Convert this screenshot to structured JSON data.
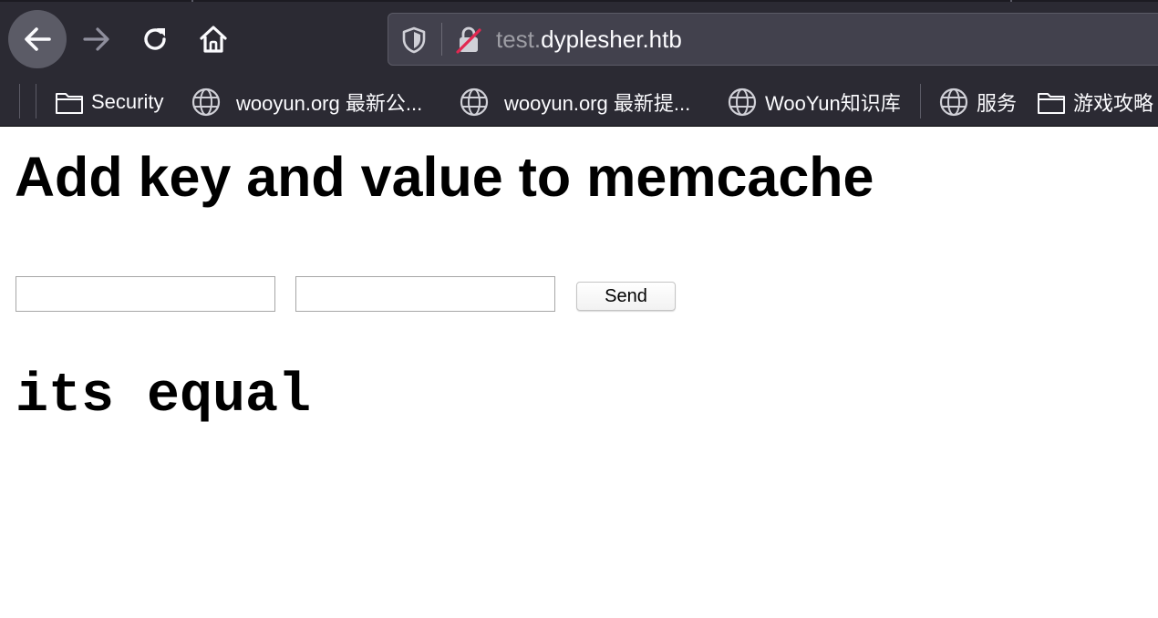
{
  "browser": {
    "url_subdomain": "test.",
    "url_domain": "dyplesher.htb",
    "icons": {
      "back": "back-arrow-icon",
      "forward": "forward-arrow-icon",
      "reload": "reload-icon",
      "home": "home-icon",
      "tracking": "shield-icon",
      "insecure": "insecure-lock-icon"
    },
    "bookmarks": [
      {
        "label": "Security",
        "icon": "folder-icon"
      },
      {
        "label": "wooyun.org 最新公...",
        "icon": "globe-icon"
      },
      {
        "label": "wooyun.org 最新提...",
        "icon": "globe-icon"
      },
      {
        "label": "WooYun知识库",
        "icon": "globe-icon"
      },
      {
        "label": "服务",
        "icon": "globe-icon"
      },
      {
        "label": "游戏攻略",
        "icon": "folder-icon"
      }
    ],
    "colors": {
      "toolbar": "#2b2a33",
      "urlbar": "#42414d",
      "text": "#fbfbfe",
      "insecure_slash": "#e22850"
    }
  },
  "page": {
    "title": "Add key and value to memcache",
    "key_input": {
      "value": "",
      "placeholder": ""
    },
    "value_input": {
      "value": "",
      "placeholder": ""
    },
    "send_label": "Send",
    "result": "its equal"
  }
}
